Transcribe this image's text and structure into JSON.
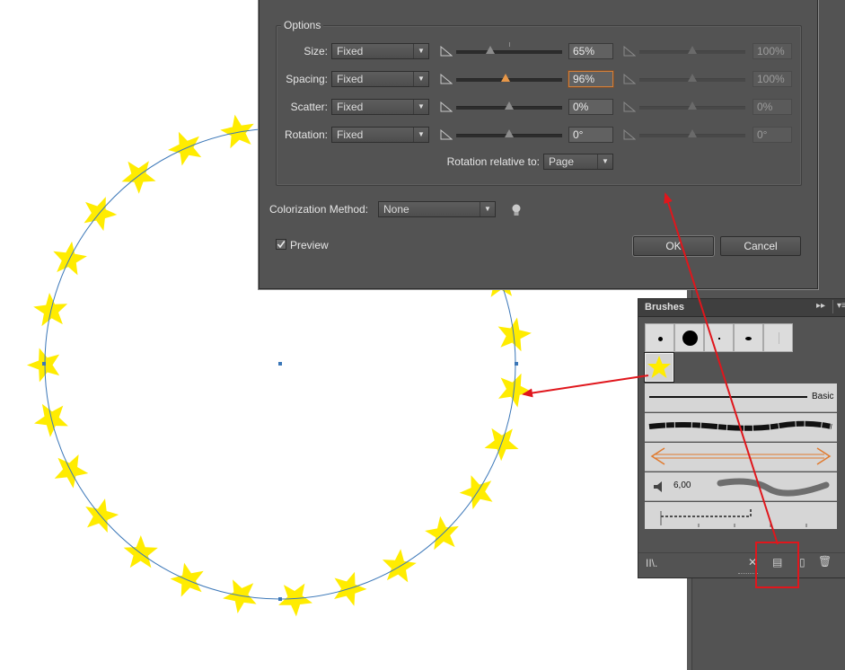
{
  "dialog": {
    "options_legend": "Options",
    "rows": [
      {
        "label": "Size:",
        "method": "Fixed",
        "value": "65%",
        "value2": "100%",
        "thumb": 0.32,
        "thumb2": 0.5,
        "focus": false
      },
      {
        "label": "Spacing:",
        "method": "Fixed",
        "value": "96%",
        "value2": "100%",
        "thumb": 0.47,
        "thumb2": 0.5,
        "focus": true
      },
      {
        "label": "Scatter:",
        "method": "Fixed",
        "value": "0%",
        "value2": "0%",
        "thumb": 0.5,
        "thumb2": 0.5,
        "focus": false
      },
      {
        "label": "Rotation:",
        "method": "Fixed",
        "value": "0°",
        "value2": "0°",
        "thumb": 0.5,
        "thumb2": 0.5,
        "focus": false
      }
    ],
    "rotation_relative_label": "Rotation relative to:",
    "rotation_relative_value": "Page",
    "colorization_label": "Colorization Method:",
    "colorization_value": "None",
    "preview_label": "Preview",
    "preview_checked": true,
    "ok_label": "OK",
    "cancel_label": "Cancel"
  },
  "brushes_panel": {
    "title": "Brushes",
    "basic_label": "Basic",
    "calligraphic_value": "6,00"
  },
  "colors": {
    "star": "#ffec00",
    "path": "#3b77b8",
    "annotation": "#e0161c"
  }
}
